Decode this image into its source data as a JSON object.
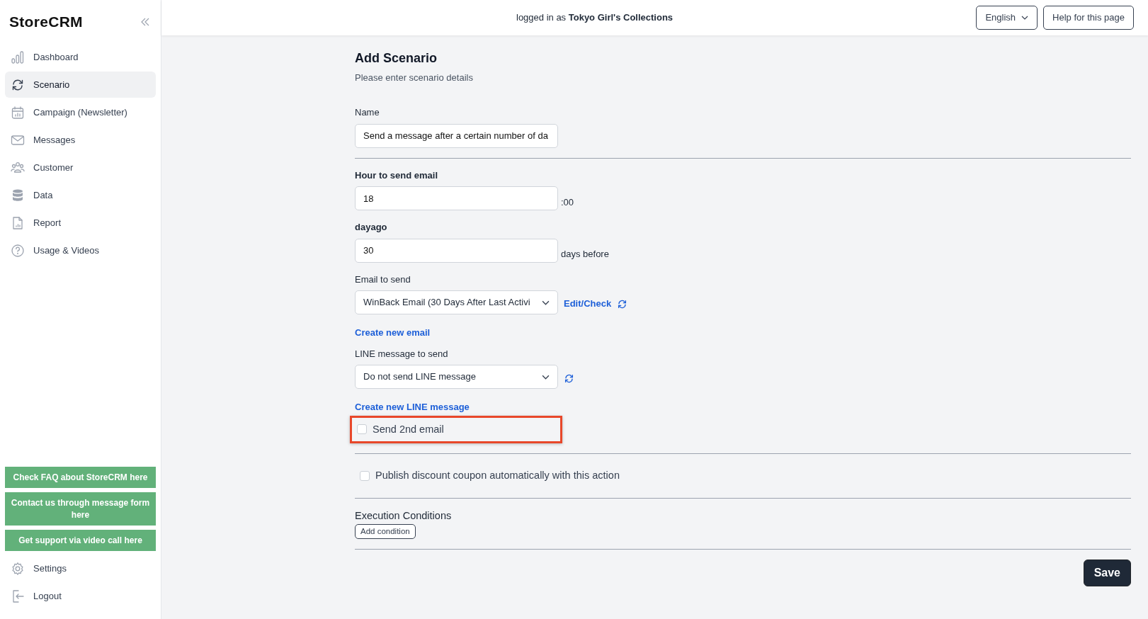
{
  "sidebar": {
    "logo": "StoreCRM",
    "items": [
      {
        "label": "Dashboard",
        "selected": false
      },
      {
        "label": "Scenario",
        "selected": true
      },
      {
        "label": "Campaign (Newsletter)",
        "selected": false
      },
      {
        "label": "Messages",
        "selected": false
      },
      {
        "label": "Customer",
        "selected": false
      },
      {
        "label": "Data",
        "selected": false
      },
      {
        "label": "Report",
        "selected": false
      },
      {
        "label": "Usage & Videos",
        "selected": false
      }
    ],
    "support_buttons": [
      "Check FAQ about StoreCRM here",
      "Contact us through message form here",
      "Get support via video call here"
    ],
    "bottom_items": [
      {
        "label": "Settings"
      },
      {
        "label": "Logout"
      }
    ]
  },
  "header": {
    "login_text": "logged in as **Tokyo Girl's Collections**",
    "language": "English",
    "help_button": "Help for this page"
  },
  "form": {
    "title": "Add Scenario",
    "subtitle": "Please enter scenario details",
    "name_field": {
      "label": "Name",
      "value": "Send a message after a certain number of da"
    },
    "hour_field": {
      "label": "Hour to send email",
      "value": "18",
      "suffix": ":00"
    },
    "dayago_field": {
      "label": "dayago",
      "value": "30",
      "suffix": "days before"
    },
    "email_select": {
      "label": "Email to send",
      "value": "WinBack Email (30 Days After Last Activi",
      "edit_link": "Edit/Check",
      "create_link": "Create new email"
    },
    "line_select": {
      "label": "LINE message to send",
      "value": "Do not send LINE message",
      "create_link": "Create new LINE message"
    },
    "checkboxes": [
      {
        "label": "Send 2nd email",
        "checked": false,
        "highlighted": true
      },
      {
        "label": "Publish discount coupon automatically with this action",
        "checked": false,
        "highlighted": false
      }
    ],
    "conditions": {
      "title": "Execution Conditions",
      "button": "Add condition"
    },
    "save_button": "Save"
  }
}
